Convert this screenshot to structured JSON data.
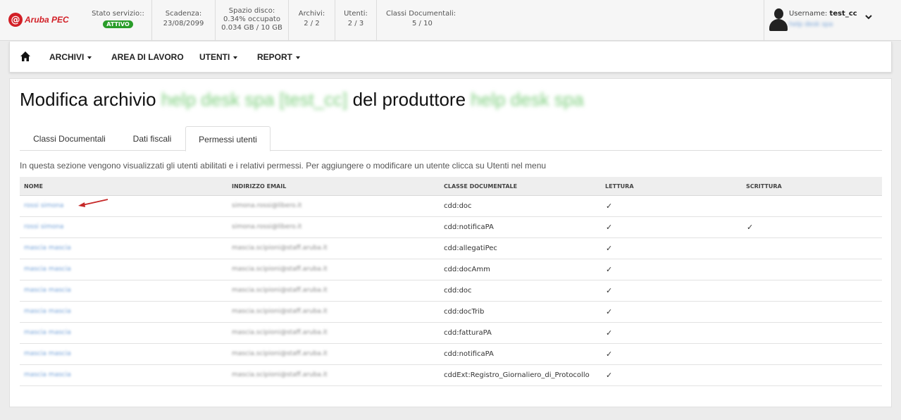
{
  "header": {
    "logo_mark": "@",
    "logo_text": "Aruba PEC",
    "stato": {
      "label": "Stato servizio::",
      "badge": "ATTIVO"
    },
    "scadenza": {
      "label": "Scadenza:",
      "value": "23/08/2099"
    },
    "spazio": {
      "label": "Spazio disco:",
      "line1": "0.34% occupato",
      "line2": "0.034 GB / 10 GB"
    },
    "archivi": {
      "label": "Archivi:",
      "value": "2 / 2"
    },
    "utenti": {
      "label": "Utenti:",
      "value": "2 / 3"
    },
    "classi": {
      "label": "Classi Documentali:",
      "value": "5 / 10"
    },
    "user": {
      "label": "Username:",
      "name": "test_cc",
      "org": "help desk spa"
    }
  },
  "nav": {
    "items": [
      "ARCHIVI",
      "AREA DI LAVORO",
      "UTENTI",
      "REPORT"
    ]
  },
  "page": {
    "title_prefix": "Modifica archivio",
    "archive_name": "help desk spa [test_cc]",
    "title_middle": "del produttore",
    "producer_name": "help desk spa"
  },
  "tabs": [
    "Classi Documentali",
    "Dati fiscali",
    "Permessi utenti"
  ],
  "info_text": "In questa sezione vengono visualizzati gli utenti abilitati e i relativi permessi. Per aggiungere o modificare un utente clicca su Utenti nel menu",
  "table": {
    "columns": [
      "NOME",
      "INDIRIZZO EMAIL",
      "CLASSE DOCUMENTALE",
      "LETTURA",
      "SCRITTURA"
    ],
    "rows": [
      {
        "nome": "rossi simona",
        "email": "simona.rossi@libero.it",
        "classe": "cdd:doc",
        "lettura": "✓",
        "scrittura": ""
      },
      {
        "nome": "rossi simona",
        "email": "simona.rossi@libero.it",
        "classe": "cdd:notificaPA",
        "lettura": "✓",
        "scrittura": "✓"
      },
      {
        "nome": "mascia mascia",
        "email": "mascia.scipioni@staff.aruba.it",
        "classe": "cdd:allegatiPec",
        "lettura": "✓",
        "scrittura": ""
      },
      {
        "nome": "mascia mascia",
        "email": "mascia.scipioni@staff.aruba.it",
        "classe": "cdd:docAmm",
        "lettura": "✓",
        "scrittura": ""
      },
      {
        "nome": "mascia mascia",
        "email": "mascia.scipioni@staff.aruba.it",
        "classe": "cdd:doc",
        "lettura": "✓",
        "scrittura": ""
      },
      {
        "nome": "mascia mascia",
        "email": "mascia.scipioni@staff.aruba.it",
        "classe": "cdd:docTrib",
        "lettura": "✓",
        "scrittura": ""
      },
      {
        "nome": "mascia mascia",
        "email": "mascia.scipioni@staff.aruba.it",
        "classe": "cdd:fatturaPA",
        "lettura": "✓",
        "scrittura": ""
      },
      {
        "nome": "mascia mascia",
        "email": "mascia.scipioni@staff.aruba.it",
        "classe": "cdd:notificaPA",
        "lettura": "✓",
        "scrittura": ""
      },
      {
        "nome": "mascia mascia",
        "email": "mascia.scipioni@staff.aruba.it",
        "classe": "cddExt:Registro_Giornaliero_di_Protocollo",
        "lettura": "✓",
        "scrittura": ""
      }
    ]
  },
  "colors": {
    "brand": "#d21f26",
    "status": "#2a9d2a",
    "link": "#6f9ed6",
    "annotation": "#c62828"
  }
}
